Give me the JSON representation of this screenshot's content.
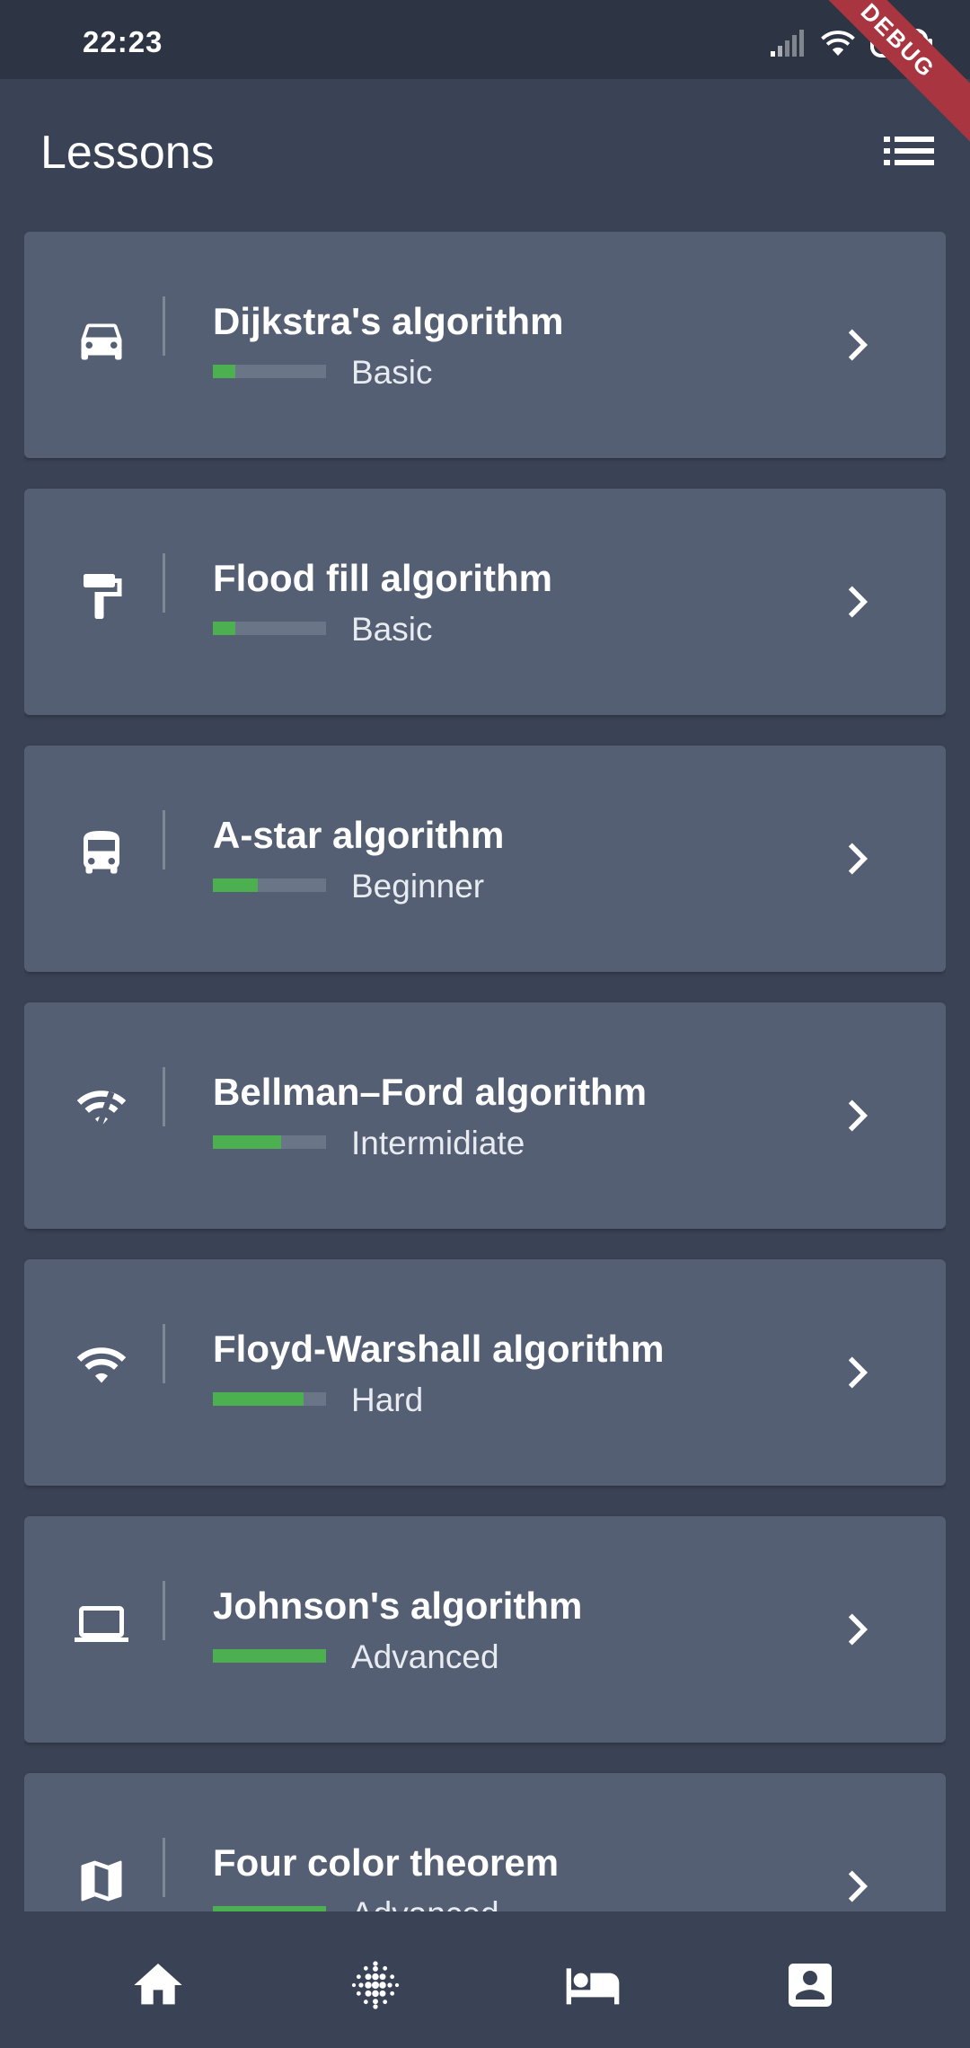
{
  "status_bar": {
    "time": "22:23",
    "debug_banner": "DEBUG"
  },
  "app_bar": {
    "title": "Lessons",
    "list_icon": "list-view-icon"
  },
  "lessons": [
    {
      "title": "Dijkstra's algorithm",
      "level": "Basic",
      "progress": 0.2,
      "icon": "car-icon"
    },
    {
      "title": "Flood fill algorithm",
      "level": "Basic",
      "progress": 0.2,
      "icon": "paint-roller-icon"
    },
    {
      "title": "A-star algorithm",
      "level": "Beginner",
      "progress": 0.4,
      "icon": "bus-icon"
    },
    {
      "title": "Bellman–Ford algorithm",
      "level": "Intermidiate",
      "progress": 0.6,
      "icon": "wifi-off-icon"
    },
    {
      "title": "Floyd-Warshall algorithm",
      "level": "Hard",
      "progress": 0.8,
      "icon": "wifi-icon"
    },
    {
      "title": "Johnson's algorithm",
      "level": "Advanced",
      "progress": 1.0,
      "icon": "laptop-icon"
    },
    {
      "title": "Four color theorem",
      "level": "Advanced",
      "progress": 1.0,
      "icon": "map-icon"
    }
  ],
  "bottom_nav": [
    {
      "icon": "home-icon"
    },
    {
      "icon": "blur-grid-icon"
    },
    {
      "icon": "hotel-bed-icon"
    },
    {
      "icon": "account-box-icon"
    }
  ],
  "colors": {
    "background": "#3a4256",
    "card": "#545f73",
    "progress_fill": "#4caf50",
    "progress_track": "#6b7588"
  }
}
